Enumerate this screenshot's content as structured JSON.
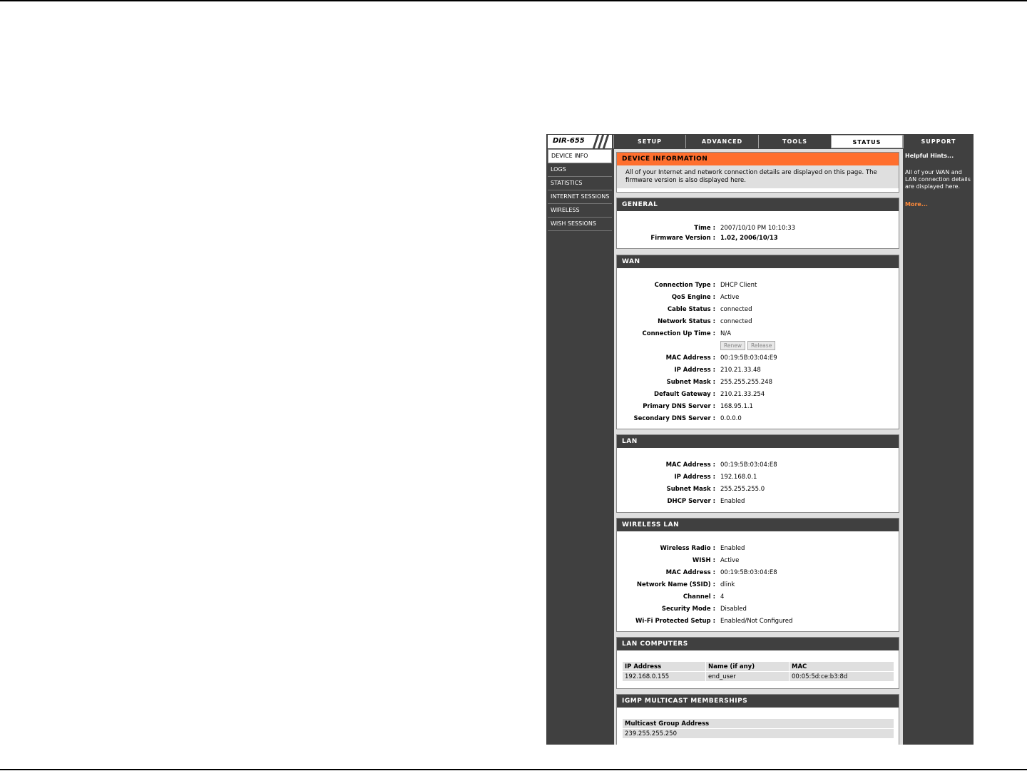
{
  "logo": "DIR-655",
  "tabs": [
    {
      "label": "SETUP"
    },
    {
      "label": "ADVANCED"
    },
    {
      "label": "TOOLS"
    },
    {
      "label": "STATUS"
    },
    {
      "label": "SUPPORT"
    }
  ],
  "sidebar": [
    {
      "label": "DEVICE INFO"
    },
    {
      "label": "LOGS"
    },
    {
      "label": "STATISTICS"
    },
    {
      "label": "INTERNET SESSIONS"
    },
    {
      "label": "WIRELESS"
    },
    {
      "label": "WISH SESSIONS"
    }
  ],
  "device_info": {
    "title": "DEVICE INFORMATION",
    "description": "All of your Internet and network connection details are displayed on this page. The firmware version is also displayed here."
  },
  "general": {
    "title": "GENERAL",
    "rows": [
      {
        "label": "Time :",
        "value": "2007/10/10 PM 10:10:33"
      },
      {
        "label": "Firmware Version :",
        "value": "1.02,  2006/10/13"
      }
    ]
  },
  "wan": {
    "title": "WAN",
    "rows_a": [
      {
        "label": "Connection Type :",
        "value": "DHCP Client"
      },
      {
        "label": "QoS Engine :",
        "value": "Active"
      },
      {
        "label": "Cable Status :",
        "value": "connected"
      },
      {
        "label": "Network Status :",
        "value": "connected"
      },
      {
        "label": "Connection Up Time :",
        "value": "N/A"
      }
    ],
    "renew_label": "Renew",
    "release_label": "Release",
    "rows_b": [
      {
        "label": "MAC Address :",
        "value": "00:19:5B:03:04:E9"
      },
      {
        "label": "IP Address :",
        "value": "210.21.33.48"
      },
      {
        "label": "Subnet Mask :",
        "value": "255.255.255.248"
      },
      {
        "label": "Default Gateway :",
        "value": "210.21.33.254"
      },
      {
        "label": "Primary DNS Server :",
        "value": "168.95.1.1"
      },
      {
        "label": "Secondary DNS Server :",
        "value": "0.0.0.0"
      }
    ]
  },
  "lan": {
    "title": "LAN",
    "rows": [
      {
        "label": "MAC Address :",
        "value": "00:19:5B:03:04:E8"
      },
      {
        "label": "IP Address :",
        "value": "192.168.0.1"
      },
      {
        "label": "Subnet Mask :",
        "value": "255.255.255.0"
      },
      {
        "label": "DHCP Server :",
        "value": "Enabled"
      }
    ]
  },
  "wireless_lan": {
    "title": "WIRELESS LAN",
    "rows": [
      {
        "label": "Wireless Radio :",
        "value": "Enabled"
      },
      {
        "label": "WISH :",
        "value": "Active"
      },
      {
        "label": "MAC Address :",
        "value": "00:19:5B:03:04:E8"
      },
      {
        "label": "Network Name (SSID) :",
        "value": "dlink"
      },
      {
        "label": "Channel :",
        "value": "4"
      },
      {
        "label": "Security Mode :",
        "value": "Disabled"
      },
      {
        "label": "Wi-Fi Protected Setup :",
        "value": "Enabled/Not Configured"
      }
    ]
  },
  "lan_computers": {
    "title": "LAN COMPUTERS",
    "headers": [
      "IP Address",
      "Name (if any)",
      "MAC"
    ],
    "rows": [
      [
        "192.168.0.155",
        "end_user",
        "00:05:5d:ce:b3:8d"
      ]
    ]
  },
  "igmp": {
    "title": "IGMP MULTICAST MEMBERSHIPS",
    "header": "Multicast Group Address",
    "rows": [
      "239.255.255.250"
    ]
  },
  "hints": {
    "title": "Helpful Hints...",
    "body": "All of your WAN and LAN connection details are displayed here.",
    "more": "More..."
  }
}
